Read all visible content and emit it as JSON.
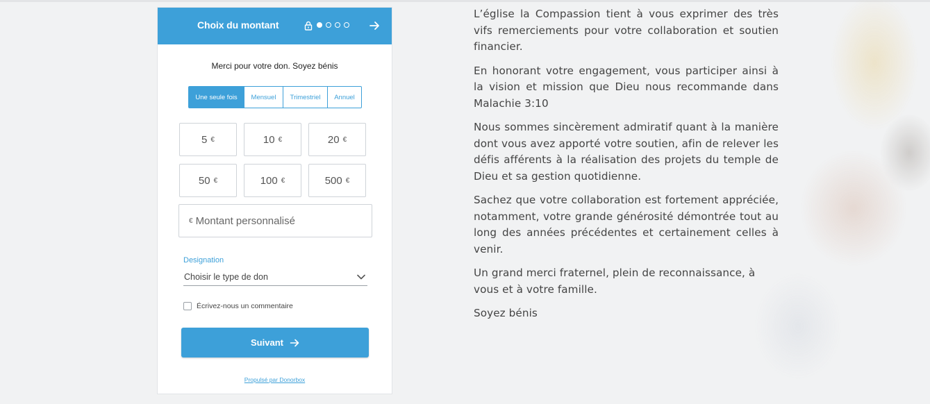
{
  "widget": {
    "title": "Choix du montant",
    "steps": [
      true,
      false,
      false,
      false
    ],
    "thanks": "Merci pour votre don. Soyez bénis",
    "frequencies": [
      {
        "label": "Une seule fois",
        "selected": true
      },
      {
        "label": "Mensuel",
        "selected": false
      },
      {
        "label": "Trimestriel",
        "selected": false
      },
      {
        "label": "Annuel",
        "selected": false
      }
    ],
    "currency": "€",
    "amounts": [
      "5",
      "10",
      "20",
      "50",
      "100",
      "500"
    ],
    "custom_placeholder": "Montant personnalisé",
    "designation_label": "Designation",
    "designation_value": "Choisir le type de don",
    "comment_label": "Écrivez-nous un commentaire",
    "submit_label": "Suivant",
    "powered_by": "Propulsé par Donorbox",
    "accent_color": "#3da0d9"
  },
  "message": {
    "paragraphs": [
      "L’église la Compassion tient à vous exprimer des très vifs remerciements pour votre collaboration et soutien financier.",
      "En honorant votre engagement, vous participer ainsi à la vision et mission que Dieu nous recommande dans Malachie 3:10",
      "Nous sommes sincèrement admiratif quant à la manière dont vous avez apporté votre soutien, afin de relever les défis afférents à la réalisation des projets du temple de Dieu et sa gestion quotidienne.",
      "Sachez que votre collaboration est fortement appréciée, notamment, votre grande générosité démontrée tout au long des années précédentes et certainement celles à venir.",
      "Un grand merci fraternel, plein de reconnaissance, à vous et à votre famille.",
      "Soyez bénis"
    ]
  }
}
